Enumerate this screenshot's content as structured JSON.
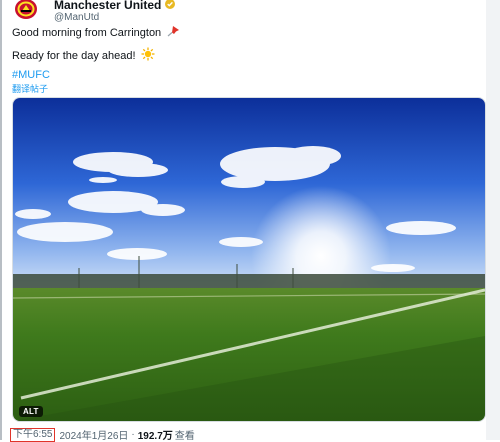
{
  "author": {
    "display_name": "Manchester United",
    "handle": "@ManUtd",
    "verified_icon": "verified-badge-icon",
    "avatar_icon": "club-crest-icon"
  },
  "tweet": {
    "line1": "Good morning from Carrington",
    "line1_icon": "pushpin-icon",
    "line2": "Ready for the day ahead!",
    "line2_icon": "sun-icon",
    "hashtag": "#MUFC",
    "translate_label": "翻译帖子"
  },
  "media": {
    "alt_badge": "ALT",
    "description_icon": "training-pitch-photo"
  },
  "meta": {
    "time": "下午6:55",
    "separator": "·",
    "date": "2024年1月26日",
    "views_count": "192.7万",
    "views_label": "查看"
  },
  "colors": {
    "link": "#1d9bf0",
    "secondary_text": "#536471",
    "highlight_border": "#e0342a",
    "verified_gold": "#e8b923"
  }
}
